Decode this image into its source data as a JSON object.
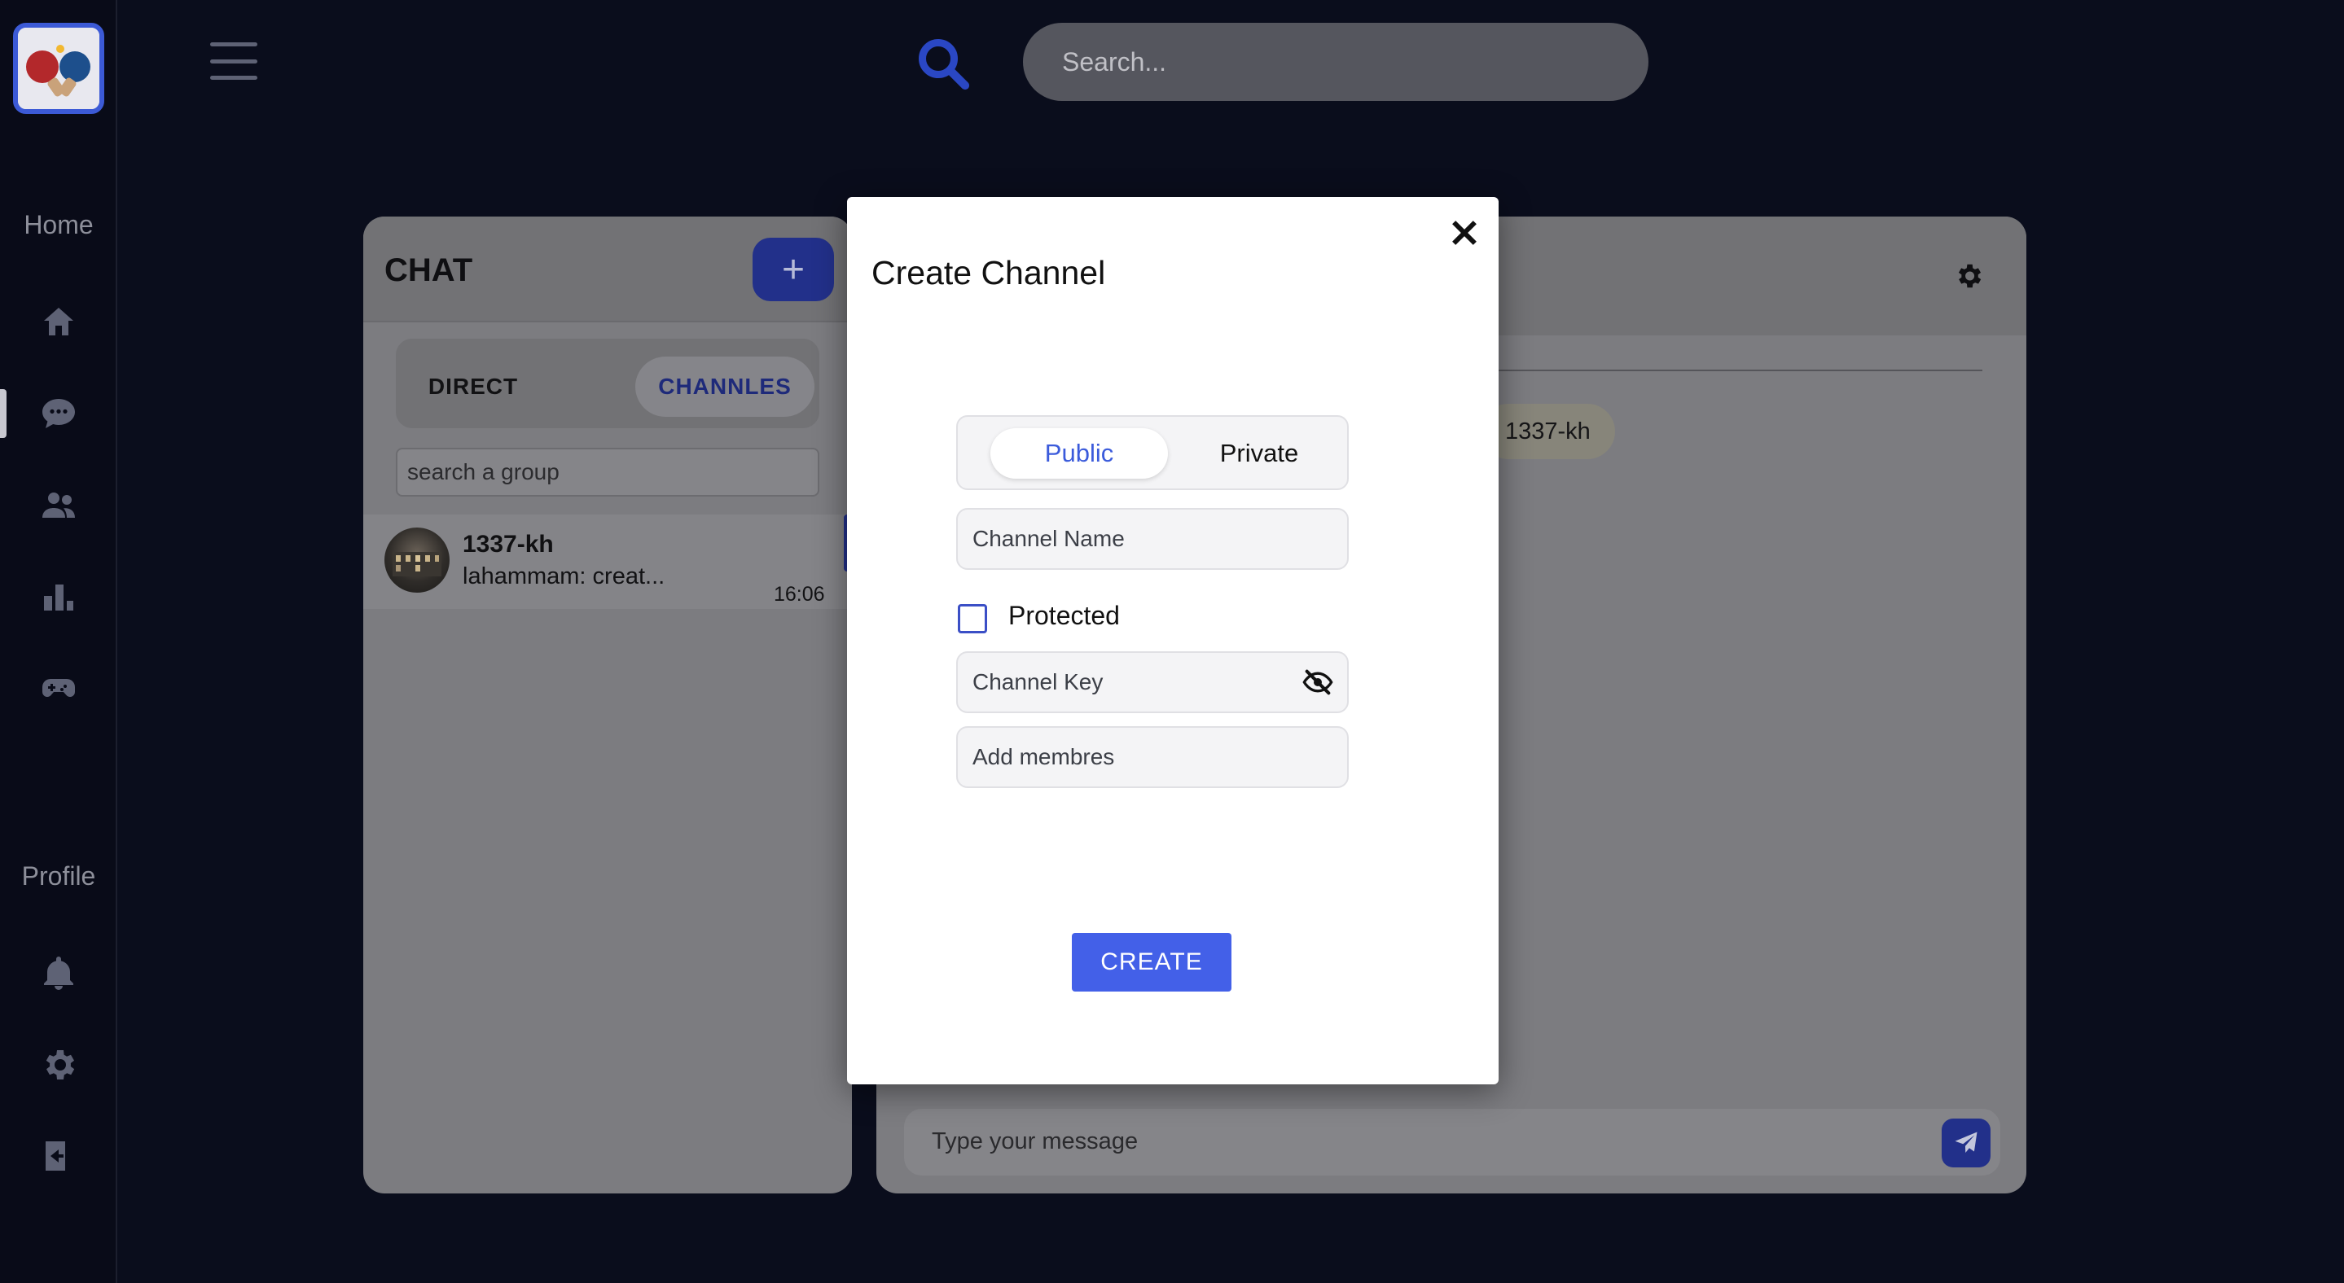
{
  "sidebar": {
    "home_label": "Home",
    "profile_label": "Profile",
    "items": [
      {
        "icon": "home-icon"
      },
      {
        "icon": "chat-icon",
        "active": true
      },
      {
        "icon": "users-icon"
      },
      {
        "icon": "leaderboard-icon"
      },
      {
        "icon": "gamepad-icon"
      },
      {
        "icon": "bell-icon"
      },
      {
        "icon": "gear-icon"
      },
      {
        "icon": "logout-icon"
      }
    ]
  },
  "topbar": {
    "search_placeholder": "Search..."
  },
  "chat_panel": {
    "title": "CHAT",
    "add_button": "+",
    "tabs": [
      {
        "label": "DIRECT"
      },
      {
        "label": "CHANNLES",
        "active": true
      }
    ],
    "group_search_placeholder": "search a group",
    "items": [
      {
        "name": "1337-kh",
        "last_message": "lahammam: creat...",
        "time": "16:06"
      }
    ]
  },
  "conversation": {
    "bubble_text": "1337-kh",
    "message_placeholder": "Type your message"
  },
  "modal": {
    "title": "Create Channel",
    "visibility_options": [
      "Public",
      "Private"
    ],
    "selected_visibility": "Public",
    "channel_name_placeholder": "Channel Name",
    "protected_label": "Protected",
    "protected_checked": false,
    "channel_key_placeholder": "Channel Key",
    "add_members_placeholder": "Add membres",
    "create_button": "CREATE"
  },
  "colors": {
    "accent": "#4360e8",
    "background": "#0a0d1c",
    "modal_bg": "#ffffff"
  }
}
